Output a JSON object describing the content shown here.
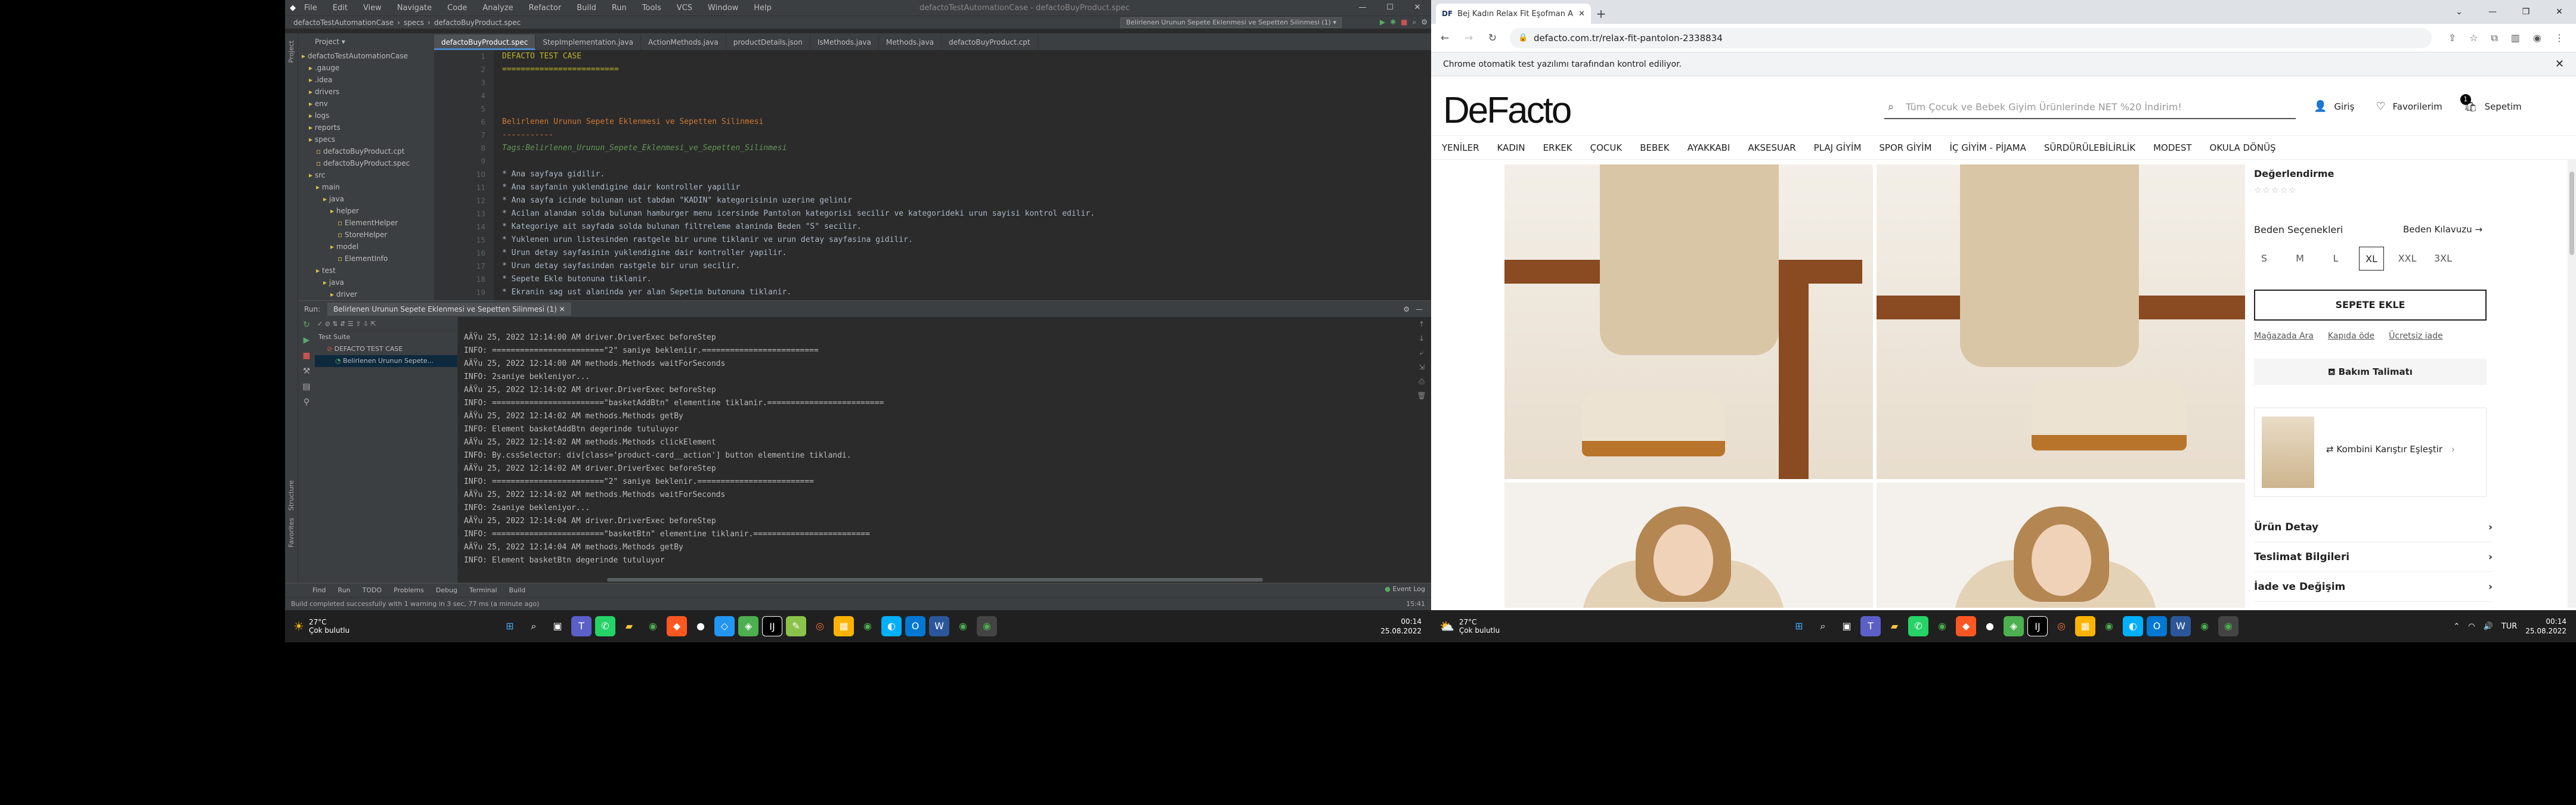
{
  "ide": {
    "menu": [
      "File",
      "Edit",
      "View",
      "Navigate",
      "Code",
      "Analyze",
      "Refactor",
      "Build",
      "Run",
      "Tools",
      "VCS",
      "Window",
      "Help"
    ],
    "window_title": "defactoTestAutomationCase - defactoBuyProduct.spec",
    "breadcrumb": [
      "defactoTestAutomationCase",
      "specs",
      "defactoBuyProduct.spec"
    ],
    "run_config": "Belirlenen Urunun Sepete Eklenmesi ve Sepetten Silinmesi (1)",
    "project_label": "Project",
    "editor_tabs": [
      "defactoBuyProduct.spec",
      "StepImplementation.java",
      "ActionMethods.java",
      "productDetails.json",
      "IsMethods.java",
      "Methods.java",
      "defactoBuyProduct.cpt"
    ],
    "tree": [
      {
        "label": "defactoTestAutomationCase"
      },
      {
        "label": ".gauge"
      },
      {
        "label": ".idea"
      },
      {
        "label": "drivers"
      },
      {
        "label": "env"
      },
      {
        "label": "logs"
      },
      {
        "label": "reports"
      },
      {
        "label": "specs"
      },
      {
        "label": "defactoBuyProduct.cpt"
      },
      {
        "label": "defactoBuyProduct.spec"
      },
      {
        "label": "src"
      },
      {
        "label": "main"
      },
      {
        "label": "java"
      },
      {
        "label": "helper"
      },
      {
        "label": "ElementHelper"
      },
      {
        "label": "StoreHelper"
      },
      {
        "label": "model"
      },
      {
        "label": "ElementInfo"
      },
      {
        "label": "test"
      },
      {
        "label": "java"
      },
      {
        "label": "driver"
      }
    ],
    "line_numbers": [
      "1",
      "2",
      "3",
      "4",
      "5",
      "6",
      "7",
      "8",
      "9",
      "10",
      "11",
      "12",
      "13",
      "14",
      "15",
      "16",
      "17",
      "18",
      "19"
    ],
    "code_lines": [
      {
        "text": "DEFACTO TEST CASE",
        "cls": "tag"
      },
      {
        "text": "=========================",
        "cls": "tag"
      },
      {
        "text": "",
        "cls": ""
      },
      {
        "text": "",
        "cls": ""
      },
      {
        "text": "",
        "cls": ""
      },
      {
        "text": "Belirlenen Urunun Sepete Eklenmesi ve Sepetten Silinmesi",
        "cls": "hd"
      },
      {
        "text": "-----------",
        "cls": "hd"
      },
      {
        "text": "Tags:Belirlenen_Urunun_Sepete_Eklenmesi_ve_Sepetten_Silinmesi",
        "cls": "sc"
      },
      {
        "text": "",
        "cls": ""
      },
      {
        "text": "* Ana sayfaya gidilir.",
        "cls": ""
      },
      {
        "text": "* Ana sayfanin yuklendigine dair kontroller yapilir",
        "cls": ""
      },
      {
        "text": "* Ana sayfa icinde bulunan ust tabdan \"KADIN\" kategorisinin uzerine gelinir",
        "cls": ""
      },
      {
        "text": "* Acilan alandan solda bulunan hamburger menu icersinde Pantolon kategorisi secilir ve kategorideki urun sayisi kontrol edilir.",
        "cls": ""
      },
      {
        "text": "* Kategoriye ait sayfada solda bulunan filtreleme alaninda Beden \"S\" secilir.",
        "cls": ""
      },
      {
        "text": "* Yuklenen urun listesinden rastgele bir urune tiklanir ve urun detay sayfasina gidilir.",
        "cls": ""
      },
      {
        "text": "* Urun detay sayfasinin yuklendigine dair kontroller yapilir.",
        "cls": ""
      },
      {
        "text": "* Urun detay sayfasindan rastgele bir urun secilir.",
        "cls": ""
      },
      {
        "text": "* Sepete Ekle butonuna tiklanir.",
        "cls": ""
      },
      {
        "text": "* Ekranin sag ust alaninda yer alan Sepetim butonuna tiklanir.",
        "cls": ""
      }
    ],
    "run_label": "Run:",
    "run_tab": "Belirlenen Urunun Sepete Eklenmesi ve Sepetten Silinmesi (1)",
    "run_tree": [
      "Test Suite",
      "DEFACTO TEST CASE",
      "Belirlenen Urunun Sepete..."
    ],
    "console": [
      "AÄŸu 25, 2022 12:14:00 AM driver.DriverExec beforeStep",
      "INFO: ========================\"2\" saniye bekleniir.=========================",
      "AÄŸu 25, 2022 12:14:00 AM methods.Methods waitForSeconds",
      "INFO: 2saniye bekleniyor...",
      "AÄŸu 25, 2022 12:14:02 AM driver.DriverExec beforeStep",
      "INFO: ========================\"basketAddBtn\" elementine tiklanir.=========================",
      "AÄŸu 25, 2022 12:14:02 AM methods.Methods getBy",
      "INFO: Element basketAddBtn degerinde tutuluyor",
      "AÄŸu 25, 2022 12:14:02 AM methods.Methods clickElement",
      "INFO: By.cssSelector: div[class='product-card__action'] button elementine tiklandi.",
      "AÄŸu 25, 2022 12:14:02 AM driver.DriverExec beforeStep",
      "INFO: ========================\"2\" saniye beklenir.=========================",
      "AÄŸu 25, 2022 12:14:02 AM methods.Methods waitForSeconds",
      "INFO: 2saniye bekleniyor...",
      "AÄŸu 25, 2022 12:14:04 AM driver.DriverExec beforeStep",
      "INFO: ========================\"basketBtn\" elementine tiklanir.=========================",
      "AÄŸu 25, 2022 12:14:04 AM methods.Methods getBy",
      "INFO: Element basketBtn degerinde tutuluyor"
    ],
    "bottom_tabs": [
      "Find",
      "Run",
      "TODO",
      "Problems",
      "Debug",
      "Terminal",
      "Build"
    ],
    "event_log": "Event Log",
    "status": "Build completed successfully with 1 warning in 3 sec, 77 ms (a minute ago)",
    "status_right": "15:41"
  },
  "taskbar_left": {
    "temp": "27°C",
    "weather": "Çok bulutlu",
    "time": "00:14",
    "date": "25.08.2022"
  },
  "taskbar_right": {
    "temp": "27°C",
    "weather": "Çok bulutlu",
    "lang": "TUR",
    "time": "00:14",
    "date": "25.08.2022"
  },
  "browser": {
    "tab_title": "Bej Kadın Relax Fit Eşofman Alt...",
    "tab_favicon": "DF",
    "url": "defacto.com.tr/relax-fit-pantolon-2338834",
    "infobar": "Chrome otomatik test yazılımı tarafından kontrol ediliyor.",
    "logo": "DeFacto",
    "search_placeholder": "Tüm Çocuk ve Bebek Giyim Ürünlerinde NET %20 İndirim!",
    "login": "Giriş",
    "favorites": "Favorilerim",
    "cart": "Sepetim",
    "cart_count": "1",
    "categories": [
      "YENİLER",
      "KADIN",
      "ERKEK",
      "ÇOCUK",
      "BEBEK",
      "AYAKKABI",
      "AKSESUAR",
      "PLAJ GİYİM",
      "SPOR GİYİM",
      "İÇ GİYİM - PİJAMA",
      "SÜRDÜRÜLEBİLİRLİK",
      "MODEST",
      "OKULA DÖNÜŞ"
    ],
    "ratings_label": "Değerlendirme",
    "rating_stars": 0,
    "size_options_label": "Beden Seçenekleri",
    "size_guide": "Beden Kılavuzu",
    "sizes": [
      "S",
      "M",
      "L",
      "XL",
      "XXL",
      "3XL"
    ],
    "selected_size": "XL",
    "add_to_cart": "SEPETE EKLE",
    "links": [
      "Mağazada Ara",
      "Kapıda öde",
      "Ücretsiz iade"
    ],
    "care": "Bakım Talimatı",
    "combine": "Kombini Karıştır Eşleştir",
    "accordions": [
      "Ürün Detay",
      "Teslimat Bilgileri",
      "İade ve Değişim"
    ]
  },
  "colors": {
    "ide_bg": "#2b2b2b",
    "ide_panel": "#3c3f41",
    "accent": "#4a88c7",
    "brand": "#111111",
    "shoe_sole": "#b8742b"
  }
}
